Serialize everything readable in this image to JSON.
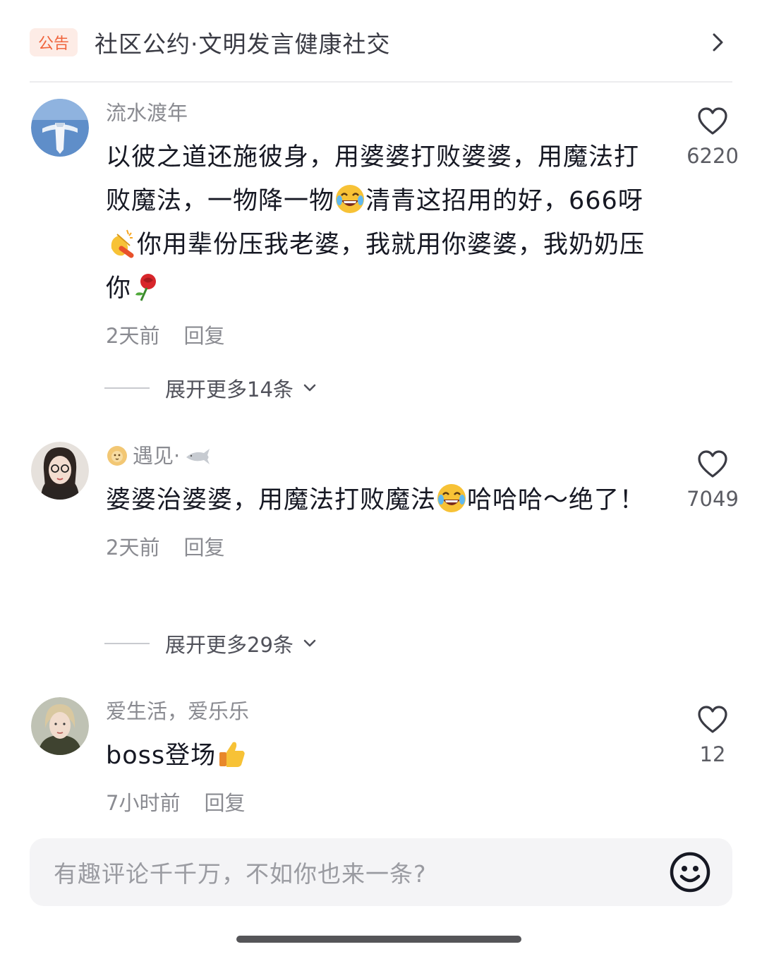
{
  "notice": {
    "badge": "公告",
    "text": "社区公约·文明发言健康社交"
  },
  "comments": [
    {
      "username": "流水渡年",
      "text_parts": [
        "以彼之道还施彼身，用婆婆打败婆婆，用魔法打败魔法，一物降一物",
        "清青这招用的好，666呀",
        "你用辈份压我老婆，我就用你婆婆，我奶奶压你",
        ""
      ],
      "emojis": [
        "laughing-tears",
        "clapping-hands",
        "rose"
      ],
      "time": "2天前",
      "reply": "回复",
      "likes": "6220",
      "expand": "展开更多14条"
    },
    {
      "username": "遇见·",
      "text_parts": [
        "婆婆治婆婆，用魔法打败魔法",
        "哈哈哈～绝了！"
      ],
      "emojis": [
        "laughing-tears"
      ],
      "time": "2天前",
      "reply": "回复",
      "likes": "7049",
      "expand": "展开更多29条"
    },
    {
      "username": "爱生活，爱乐乐",
      "text_parts": [
        "boss登场",
        ""
      ],
      "emojis": [
        "thumbs-up"
      ],
      "time": "7小时前",
      "reply": "回复",
      "likes": "12"
    }
  ],
  "input": {
    "placeholder": "有趣评论千千万，不如你也来一条?"
  },
  "colors": {
    "badge_bg": "#fdece6",
    "badge_text": "#f0643c",
    "secondary_text": "#8a8b91",
    "input_bg": "#f4f4f6"
  }
}
